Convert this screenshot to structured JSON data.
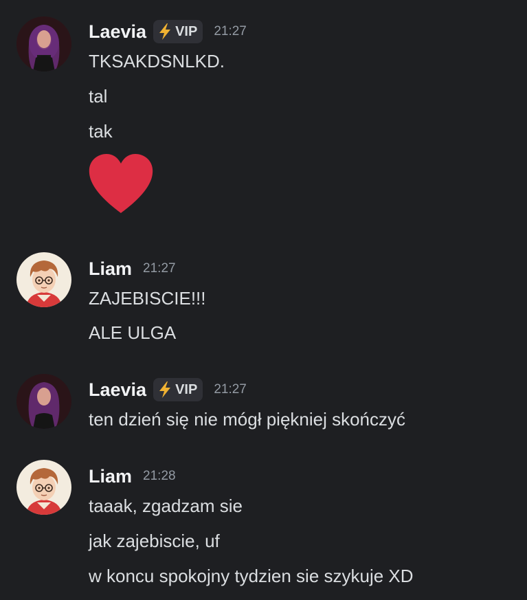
{
  "messages": [
    {
      "username": "Laevia",
      "badge": "VIP",
      "badge_icon": "lightning-bolt-icon",
      "timestamp": "21:27",
      "lines": [
        "TKSAKDSNLKD.",
        "tal",
        "tak"
      ],
      "emoji": "red-heart-icon",
      "avatar": "laevia-avatar"
    },
    {
      "username": "Liam",
      "timestamp": "21:27",
      "lines": [
        "ZAJEBISCIE!!!",
        "ALE ULGA"
      ],
      "avatar": "liam-avatar"
    },
    {
      "username": "Laevia",
      "badge": "VIP",
      "badge_icon": "lightning-bolt-icon",
      "timestamp": "21:27",
      "lines": [
        "ten dzień się nie mógł piękniej skończyć"
      ],
      "avatar": "laevia-avatar"
    },
    {
      "username": "Liam",
      "timestamp": "21:28",
      "lines": [
        "taaak, zgadzam sie",
        "jak zajebiscie, uf",
        "w koncu spokojny tydzien sie szykuje XD"
      ],
      "avatar": "liam-avatar"
    }
  ],
  "colors": {
    "background": "#1e1f22",
    "text": "#dbdee1",
    "username": "#f2f3f5",
    "timestamp": "#949ba4",
    "badge_bg": "#2f3036",
    "bolt": "#f0b232",
    "heart": "#dd2e44"
  }
}
